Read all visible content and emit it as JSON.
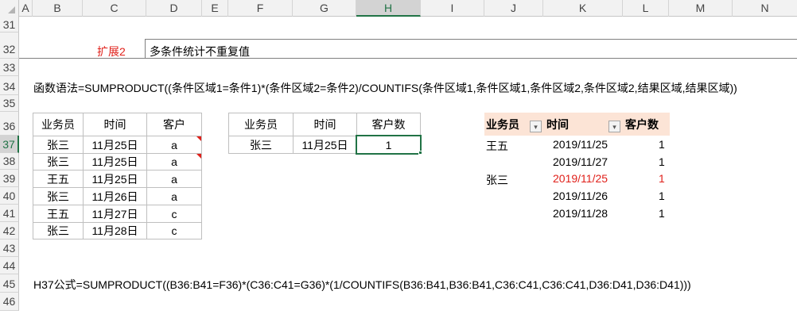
{
  "columns": [
    "A",
    "B",
    "C",
    "D",
    "E",
    "F",
    "G",
    "H",
    "I",
    "J",
    "K",
    "L",
    "M",
    "N"
  ],
  "rows": [
    "31",
    "32",
    "33",
    "34",
    "35",
    "36",
    "37",
    "38",
    "39",
    "40",
    "41",
    "42",
    "43",
    "44",
    "45",
    "46"
  ],
  "title": {
    "label": "扩展2",
    "text": "多条件统计不重复值"
  },
  "syntax": "函数语法=SUMPRODUCT((条件区域1=条件1)*(条件区域2=条件2)/COUNTIFS(条件区域1,条件区域1,条件区域2,条件区域2,结果区域,结果区域))",
  "source_table": {
    "headers": [
      "业务员",
      "时间",
      "客户"
    ],
    "rows": [
      [
        "张三",
        "11月25日",
        "a"
      ],
      [
        "张三",
        "11月25日",
        "a"
      ],
      [
        "王五",
        "11月25日",
        "a"
      ],
      [
        "张三",
        "11月26日",
        "a"
      ],
      [
        "王五",
        "11月27日",
        "c"
      ],
      [
        "张三",
        "11月28日",
        "c"
      ]
    ]
  },
  "lookup_table": {
    "headers": [
      "业务员",
      "时间",
      "客户数"
    ],
    "row": [
      "张三",
      "11月25日",
      "1"
    ]
  },
  "pivot": {
    "headers": [
      "业务员",
      "时间",
      "客户数"
    ],
    "rows": [
      [
        "王五",
        "2019/11/25",
        "1"
      ],
      [
        "",
        "2019/11/27",
        "1"
      ],
      [
        "张三",
        "2019/11/25",
        "1"
      ],
      [
        "",
        "2019/11/26",
        "1"
      ],
      [
        "",
        "2019/11/28",
        "1"
      ]
    ],
    "highlight_color": "#e0201a"
  },
  "formula": "H37公式=SUMPRODUCT((B36:B41=F36)*(C36:C41=G36)*(1/COUNTIFS(B36:B41,B36:B41,C36:C41,C36:C41,D36:D41,D36:D41)))",
  "colors": {
    "accent": "#217346",
    "title_red": "#e0201a",
    "pivot_header": "#fce4d6"
  }
}
